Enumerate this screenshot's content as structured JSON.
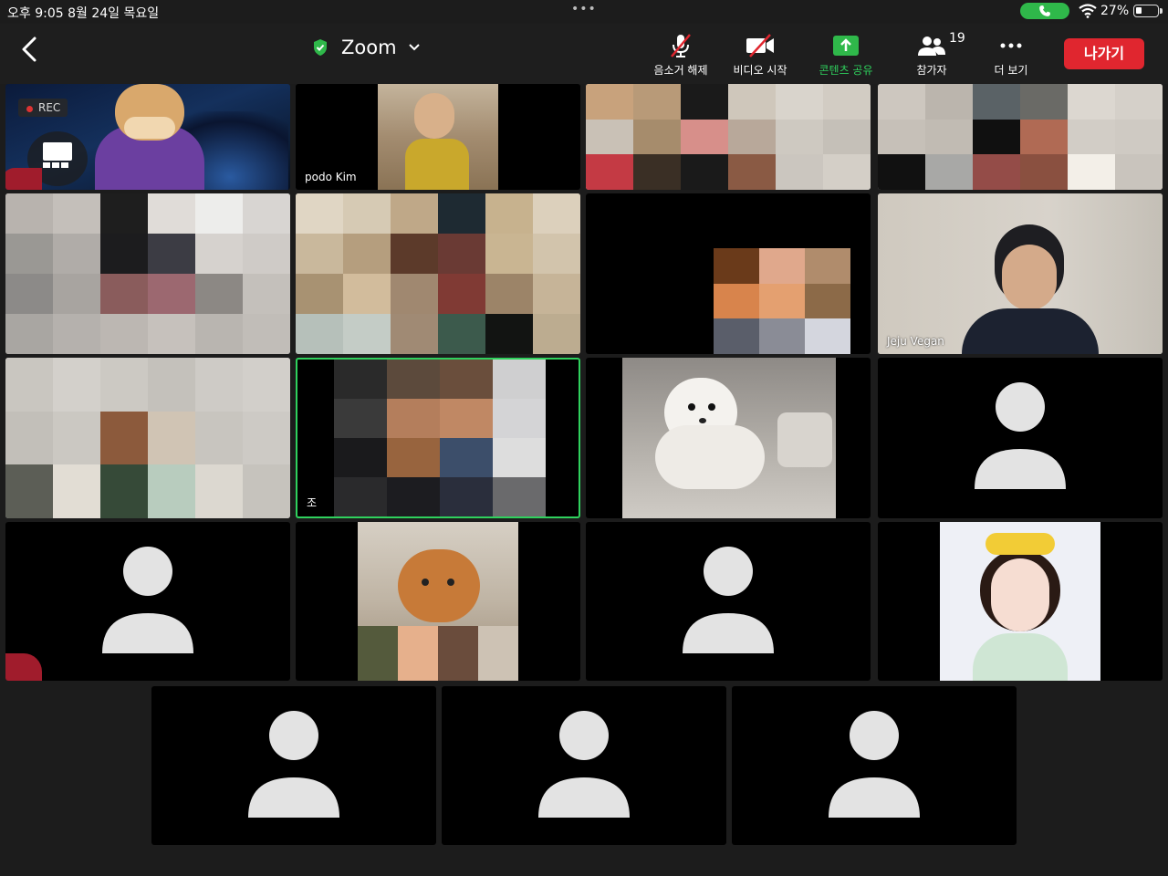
{
  "status_bar": {
    "time": "오후 9:05  8월 24일 목요일",
    "battery": "27%",
    "battery_level": 0.27,
    "dots": "•••"
  },
  "toolbar": {
    "title": "Zoom",
    "buttons": [
      {
        "id": "unmute",
        "label": "음소거 해제",
        "icon": "mic-muted-icon"
      },
      {
        "id": "start-video",
        "label": "비디오 시작",
        "icon": "video-off-icon"
      },
      {
        "id": "share",
        "label": "콘텐츠 공유",
        "icon": "share-screen-icon"
      },
      {
        "id": "participants",
        "label": "참가자",
        "icon": "participants-icon"
      },
      {
        "id": "more",
        "label": "더 보기",
        "icon": "more-icon"
      }
    ],
    "participant_count": "19",
    "leave_label": "나가기"
  },
  "tiles": {
    "rec_label": "REC",
    "podo": "podo Kim",
    "jeju": "Jeju Vegan",
    "partial_name": "조"
  },
  "colors": {
    "accent_green": "#2fd15d",
    "leave_red": "#e0262f",
    "tile_bg": "#000000"
  }
}
